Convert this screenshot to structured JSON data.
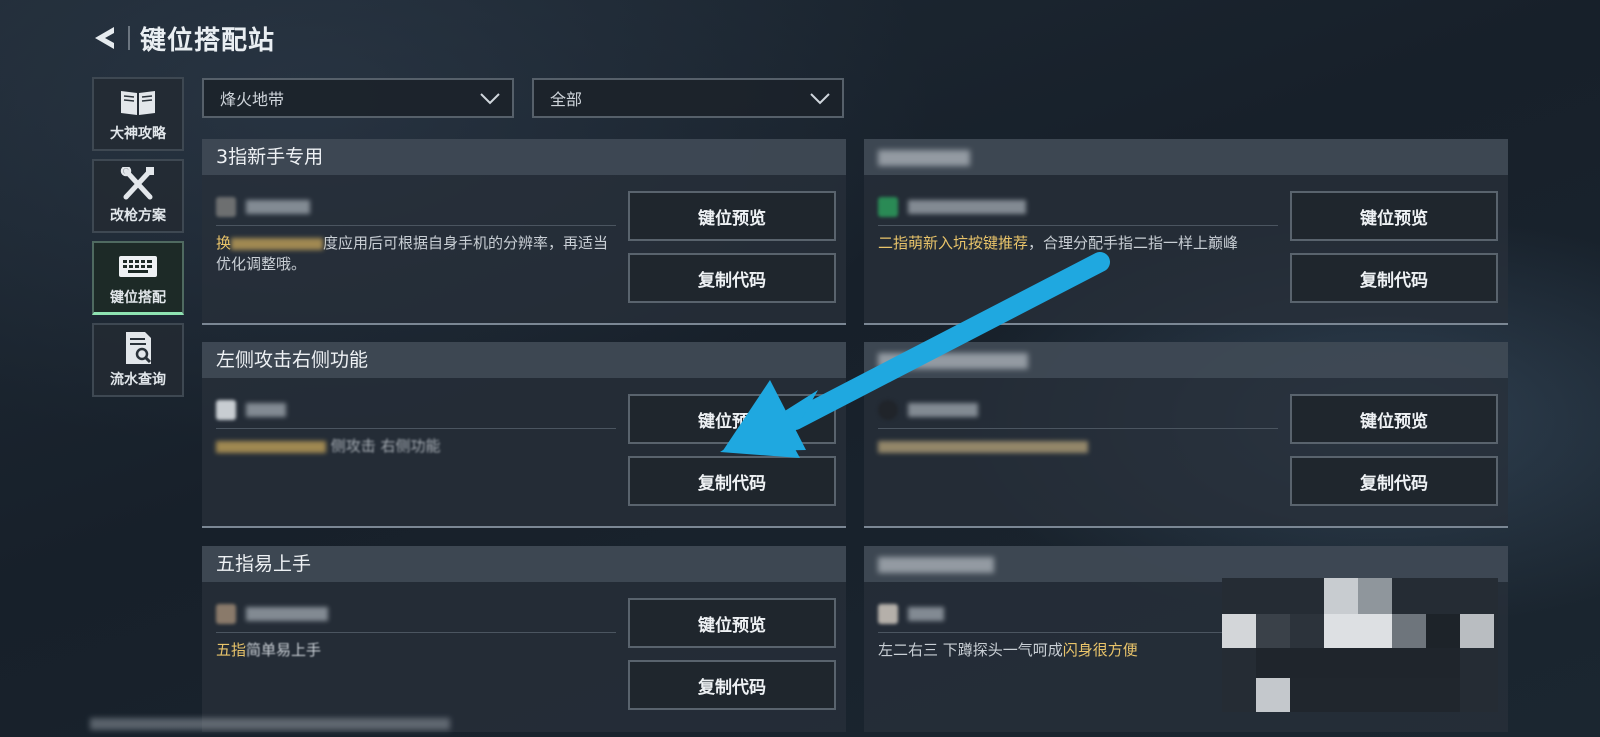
{
  "header": {
    "back_icon": "back-arrow-icon",
    "title": "键位搭配站"
  },
  "nav": {
    "items": [
      {
        "label": "大神攻略",
        "icon": "book-icon",
        "active": false
      },
      {
        "label": "改枪方案",
        "icon": "tools-icon",
        "active": false
      },
      {
        "label": "键位搭配",
        "icon": "keyboard-icon",
        "active": true
      },
      {
        "label": "流水查询",
        "icon": "document-search-icon",
        "active": false
      }
    ]
  },
  "filters": {
    "mode": {
      "value": "烽火地带",
      "icon": "chevron-down-icon"
    },
    "category": {
      "value": "全部",
      "icon": "chevron-down-icon"
    }
  },
  "buttons": {
    "preview_label": "键位预览",
    "copy_label": "复制代码"
  },
  "cards": [
    {
      "title": "3指新手专用",
      "desc_prefix": "换",
      "desc_text": "度应用后可根据自身手机的分辨率，再适当优化调整哦。",
      "desc_highlight": ""
    },
    {
      "title": "",
      "desc_prefix": "",
      "desc_highlight": "二指萌新入坑按键推荐",
      "desc_text": "，合理分配手指二指一样上巅峰"
    },
    {
      "title": "左侧攻击右侧功能",
      "desc_prefix": "",
      "desc_text": "侧攻击 右侧功能",
      "desc_highlight": ""
    },
    {
      "title": "",
      "desc_prefix": "",
      "desc_text": "",
      "desc_highlight": ""
    },
    {
      "title": "五指易上手",
      "desc_prefix": "",
      "desc_highlight": "五指",
      "desc_text": "简单易上手"
    },
    {
      "title": "",
      "desc_prefix": "",
      "desc_text": "左二右三 下蹲探头一气呵成",
      "desc_highlight": "闪身很方便"
    }
  ],
  "colors": {
    "highlight": "#e9c46a",
    "active_nav_accent": "#8fe3b2",
    "annotation_arrow": "#1fa8e0"
  }
}
